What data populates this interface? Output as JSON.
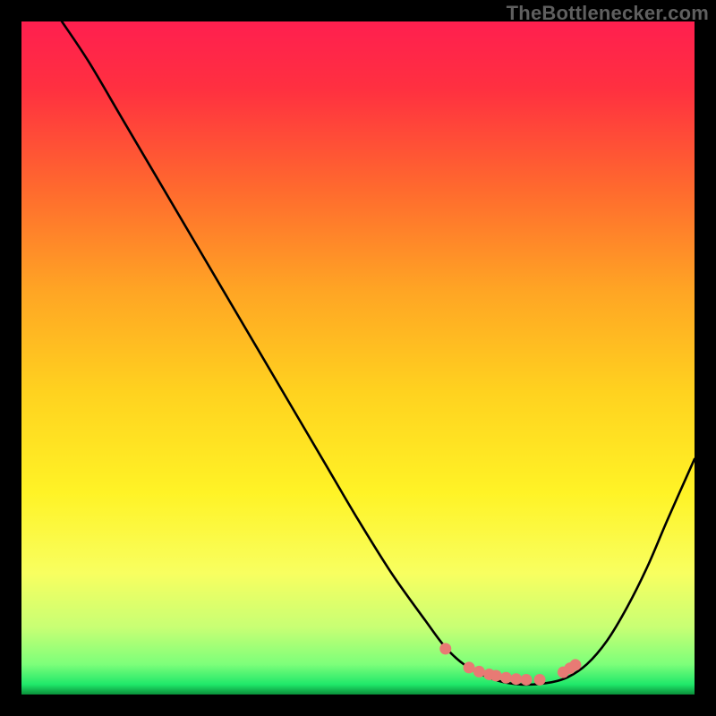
{
  "watermark": "TheBottlenecker.com",
  "chart_data": {
    "type": "line",
    "title": "",
    "xlabel": "",
    "ylabel": "",
    "xlim": [
      0,
      100
    ],
    "ylim": [
      0,
      100
    ],
    "series": [
      {
        "name": "curve",
        "x": [
          6,
          10,
          15,
          20,
          25,
          30,
          35,
          40,
          45,
          50,
          55,
          60,
          63,
          66,
          70,
          74,
          78,
          81,
          84,
          87,
          90,
          93,
          96,
          100
        ],
        "y": [
          100,
          94,
          85.5,
          77,
          68.5,
          60,
          51.5,
          43,
          34.5,
          26,
          18,
          11,
          7,
          4.3,
          2.3,
          1.5,
          1.7,
          2.5,
          4.5,
          8,
          13,
          19,
          26,
          35
        ]
      }
    ],
    "markers": {
      "name": "dots",
      "color": "#e87a74",
      "x": [
        63.0,
        66.5,
        68.0,
        69.5,
        70.5,
        72.0,
        73.5,
        75.0,
        77.0,
        80.5,
        81.5,
        82.3
      ],
      "y": [
        6.8,
        4.0,
        3.4,
        3.0,
        2.8,
        2.5,
        2.3,
        2.2,
        2.2,
        3.3,
        3.9,
        4.4
      ]
    },
    "gradient_stops": [
      {
        "offset": 0.0,
        "color": "#ff1f4f"
      },
      {
        "offset": 0.1,
        "color": "#ff3040"
      },
      {
        "offset": 0.25,
        "color": "#ff6a2e"
      },
      {
        "offset": 0.4,
        "color": "#ffa524"
      },
      {
        "offset": 0.55,
        "color": "#ffd21f"
      },
      {
        "offset": 0.7,
        "color": "#fff326"
      },
      {
        "offset": 0.82,
        "color": "#f8ff60"
      },
      {
        "offset": 0.9,
        "color": "#c8ff74"
      },
      {
        "offset": 0.955,
        "color": "#7dff7a"
      },
      {
        "offset": 0.985,
        "color": "#20e86a"
      },
      {
        "offset": 1.0,
        "color": "#0a8f3a"
      }
    ]
  }
}
